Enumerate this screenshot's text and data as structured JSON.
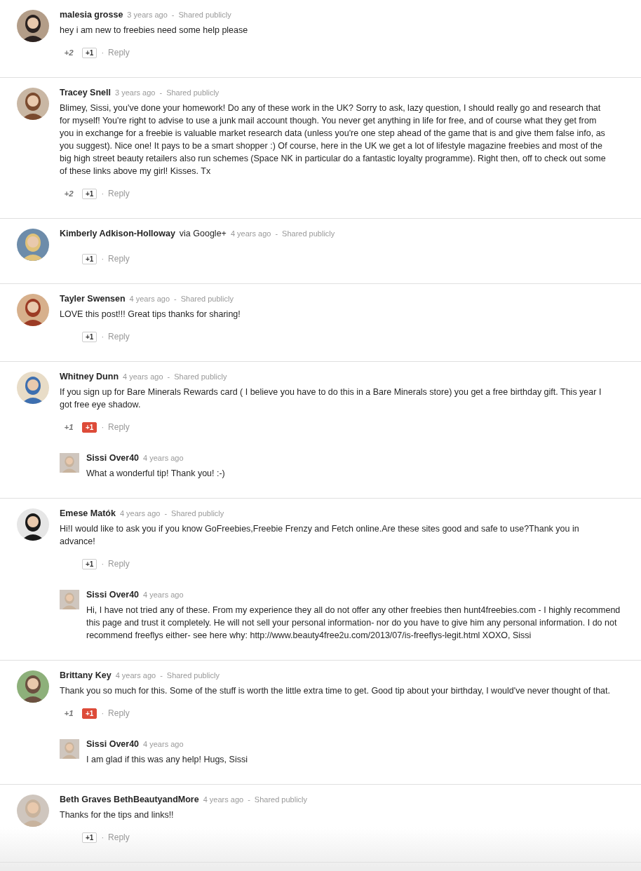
{
  "comments": [
    {
      "author": "malesia grosse",
      "time": "3 years ago",
      "sep": "-",
      "visibility": "Shared publicly",
      "text": "hey i am new to freebies need some help please",
      "count": "+2",
      "plus": "+1",
      "plus_selected": false,
      "reply_sep": "·",
      "reply": "Reply"
    },
    {
      "author": "Tracey Snell",
      "time": "3 years ago",
      "sep": "-",
      "visibility": "Shared publicly",
      "text": "Blimey, Sissi, you've done your homework! Do any of these work in the UK? Sorry to ask, lazy question, I should really go and research that for myself! You're right to advise to use a junk mail account though. You never get anything in life for free, and of course what they get from you in exchange for a freebie is valuable market research data  (unless you're one step ahead of the game that is and give them false info, as you suggest). Nice one! It pays to be a smart shopper :) Of course, here in the UK we get a lot of lifestyle magazine freebies and most of the big high street beauty retailers also run schemes (Space NK in particular do a fantastic loyalty programme). Right then, off to check out some of these links above my girl! Kisses. Tx",
      "count": "+2",
      "plus": "+1",
      "plus_selected": false,
      "reply_sep": "·",
      "reply": "Reply"
    },
    {
      "author": "Kimberly Adkison-Holloway",
      "via": "via Google+",
      "time": "4 years ago",
      "sep": "-",
      "visibility": "Shared publicly",
      "plus": "+1",
      "plus_selected": false,
      "reply_sep": "·",
      "reply": "Reply"
    },
    {
      "author": "Tayler Swensen",
      "time": "4 years ago",
      "sep": "-",
      "visibility": "Shared publicly",
      "text": "LOVE this post!!! Great tips thanks for sharing!",
      "plus": "+1",
      "plus_selected": false,
      "reply_sep": "·",
      "reply": "Reply"
    },
    {
      "author": "Whitney Dunn",
      "time": "4 years ago",
      "sep": "-",
      "visibility": "Shared publicly",
      "text": "If you sign up for Bare Minerals Rewards card ( I believe you have to do this in a Bare Minerals store) you get a free birthday gift. This year I got free eye shadow.",
      "count": "+1",
      "plus": "+1",
      "plus_selected": true,
      "reply_sep": "·",
      "reply": "Reply",
      "replies": [
        {
          "author": "Sissi Over40",
          "time": "4 years ago",
          "text": "What a wonderful tip! Thank you! :-)"
        }
      ]
    },
    {
      "author": "Emese Matók",
      "time": "4 years ago",
      "sep": "-",
      "visibility": "Shared publicly",
      "text": "Hi!I would like to ask you if you know GoFreebies,Freebie Frenzy and Fetch online.Are these sites good and safe to use?Thank you in advance!",
      "plus": "+1",
      "plus_selected": false,
      "reply_sep": "·",
      "reply": "Reply",
      "replies": [
        {
          "author": "Sissi Over40",
          "time": "4 years ago",
          "text": "Hi, I have not tried any of these. From my experience they all do not offer any other freebies then hunt4freebies.com - I highly recommend this page and trust it completely. He will not sell your personal information- nor do you have to give him any personal information. I do not recommend freeflys either- see here why:  http://www.beauty4free2u.com/2013/07/is-freeflys-legit.html XOXO, Sissi"
        }
      ]
    },
    {
      "author": "Brittany Key",
      "time": "4 years ago",
      "sep": "-",
      "visibility": "Shared publicly",
      "text": "Thank you so much for this.  Some of the stuff is worth the little extra time to get.  Good tip about your birthday,  I would've never thought of that.",
      "count": "+1",
      "plus": "+1",
      "plus_selected": true,
      "reply_sep": "·",
      "reply": "Reply",
      "replies": [
        {
          "author": "Sissi Over40",
          "time": "4 years ago",
          "text": "I am glad if this was any help! Hugs, Sissi"
        }
      ]
    },
    {
      "author": "Beth Graves BethBeautyandMore",
      "time": "4 years ago",
      "sep": "-",
      "visibility": "Shared publicly",
      "text": "Thanks for the tips and links!!",
      "plus": "+1",
      "plus_selected": false,
      "reply_sep": "·",
      "reply": "Reply"
    }
  ]
}
